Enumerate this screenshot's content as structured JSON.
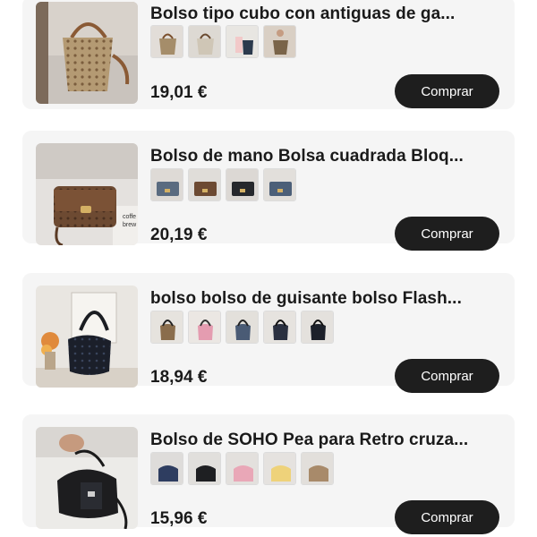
{
  "products": [
    {
      "title": "Bolso tipo cubo con antiguas de ga...",
      "price": "19,01 €",
      "buy_label": "Comprar"
    },
    {
      "title": "Bolso de mano Bolsa cuadrada Bloq...",
      "price": "20,19 €",
      "buy_label": "Comprar"
    },
    {
      "title": "bolso bolso de guisante bolso Flash...",
      "price": "18,94 €",
      "buy_label": "Comprar"
    },
    {
      "title": "Bolso de SOHO Pea para Retro cruza...",
      "price": "15,96 €",
      "buy_label": "Comprar"
    }
  ],
  "thumbnail_texts": {
    "box_text_1": "coffe",
    "box_text_2": "brew"
  },
  "colors": {
    "card_background": "#f5f5f5",
    "button_background": "#1e1e1e",
    "button_text": "#ffffff",
    "text": "#1a1a1a"
  }
}
